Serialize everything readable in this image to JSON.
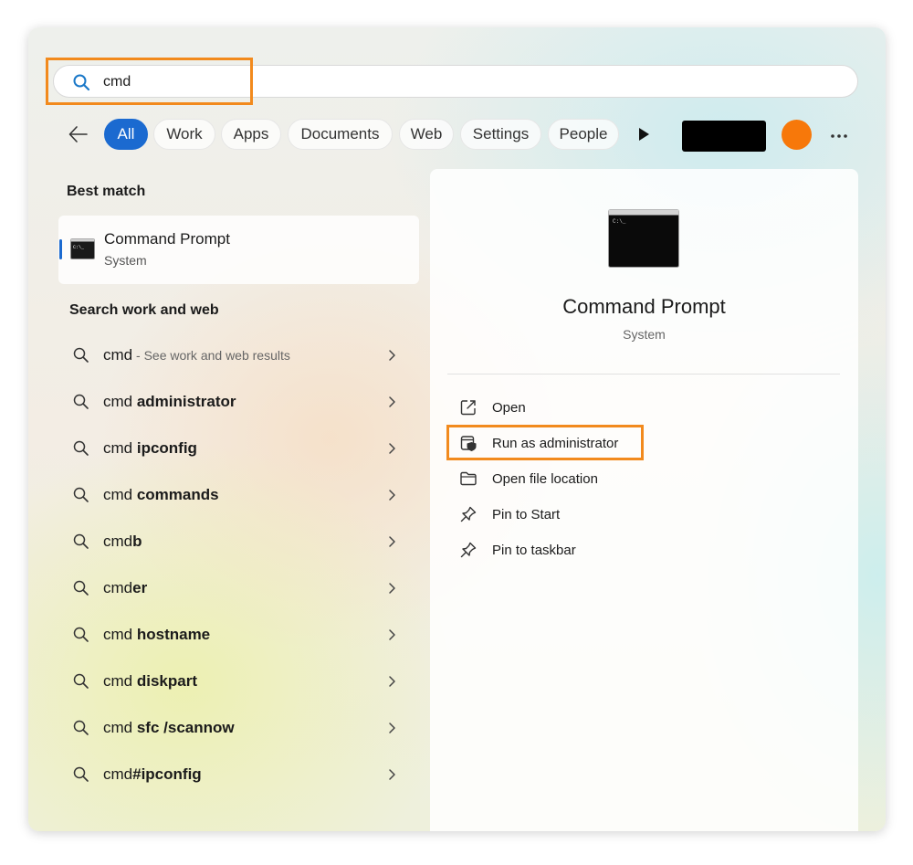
{
  "search": {
    "query": "cmd"
  },
  "filters": {
    "tabs": [
      {
        "label": "All",
        "active": true
      },
      {
        "label": "Work"
      },
      {
        "label": "Apps"
      },
      {
        "label": "Documents"
      },
      {
        "label": "Web"
      },
      {
        "label": "Settings"
      },
      {
        "label": "People"
      }
    ],
    "more_icon": "more-icon",
    "play_icon": "play-icon",
    "avatar_color": "#f7780a"
  },
  "best_match": {
    "heading": "Best match",
    "title": "Command Prompt",
    "subtitle": "System"
  },
  "web": {
    "heading": "Search work and web",
    "results": [
      {
        "prefix": "cmd",
        "bold": "",
        "suffix": " - See work and web results"
      },
      {
        "prefix": "cmd ",
        "bold": "administrator",
        "suffix": ""
      },
      {
        "prefix": "cmd ",
        "bold": "ipconfig",
        "suffix": ""
      },
      {
        "prefix": "cmd ",
        "bold": "commands",
        "suffix": ""
      },
      {
        "prefix": "cmd",
        "bold": "b",
        "suffix": ""
      },
      {
        "prefix": "cmd",
        "bold": "er",
        "suffix": ""
      },
      {
        "prefix": "cmd ",
        "bold": "hostname",
        "suffix": ""
      },
      {
        "prefix": "cmd ",
        "bold": "diskpart",
        "suffix": ""
      },
      {
        "prefix": "cmd ",
        "bold": "sfc /scannow",
        "suffix": ""
      },
      {
        "prefix": "cmd",
        "bold": "#ipconfig",
        "suffix": ""
      }
    ]
  },
  "detail": {
    "title": "Command Prompt",
    "subtitle": "System",
    "actions": [
      {
        "label": "Open",
        "icon": "open-external-icon"
      },
      {
        "label": "Run as administrator",
        "icon": "shield-icon"
      },
      {
        "label": "Open file location",
        "icon": "folder-icon"
      },
      {
        "label": "Pin to Start",
        "icon": "pin-icon"
      },
      {
        "label": "Pin to taskbar",
        "icon": "pin-icon"
      }
    ]
  },
  "colors": {
    "accent": "#1b6ad0",
    "highlight": "#f28a1d"
  }
}
